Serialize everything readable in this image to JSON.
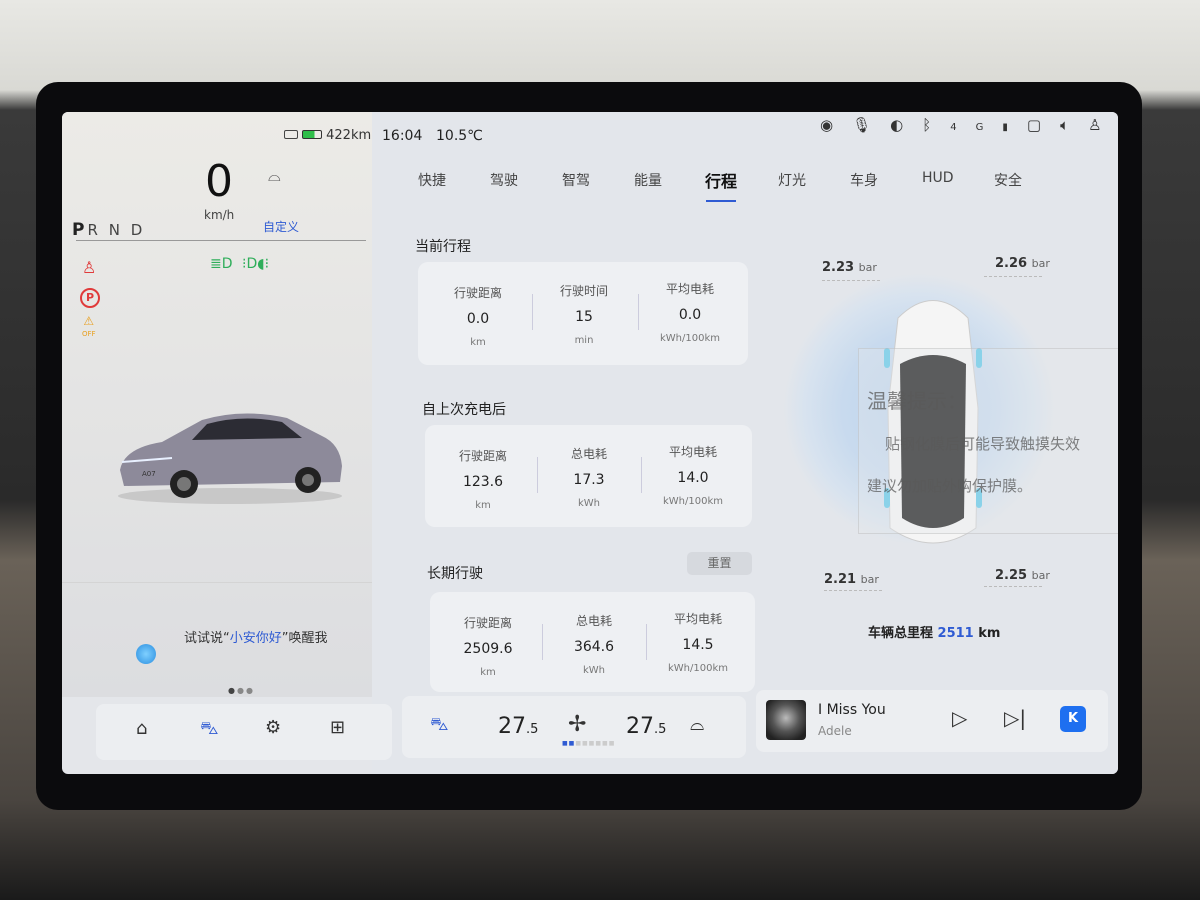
{
  "cluster": {
    "range": "422km",
    "speed": "0",
    "speed_unit": "km/h",
    "custom": "自定义",
    "gears": [
      "P",
      "R",
      "N",
      "D"
    ],
    "active_gear": "P",
    "voice_prompt_prefix": "试试说“",
    "voice_wake_word": "小安你好",
    "voice_prompt_suffix": "”唤醒我",
    "car_badge": "A07",
    "page_dots": 3,
    "page_active": 1,
    "off_label": "OFF"
  },
  "status": {
    "time": "16:04",
    "temperature": "10.5℃",
    "icons": [
      "camera-icon",
      "microphone-icon",
      "satellite-icon",
      "bluetooth-icon",
      "signal-4g-icon",
      "dashcam-icon",
      "volume-icon",
      "user-icon"
    ],
    "signal_label": "4G"
  },
  "tabs": [
    {
      "label": "快捷"
    },
    {
      "label": "驾驶"
    },
    {
      "label": "智驾"
    },
    {
      "label": "能量"
    },
    {
      "label": "行程",
      "active": true
    },
    {
      "label": "灯光"
    },
    {
      "label": "车身"
    },
    {
      "label": "HUD"
    },
    {
      "label": "安全"
    }
  ],
  "trips": {
    "current": {
      "title": "当前行程",
      "cells": [
        {
          "label": "行驶距离",
          "value": "0.0",
          "unit": "km"
        },
        {
          "label": "行驶时间",
          "value": "15",
          "unit": "min"
        },
        {
          "label": "平均电耗",
          "value": "0.0",
          "unit": "kWh/100km"
        }
      ]
    },
    "since_charge": {
      "title": "自上次充电后",
      "cells": [
        {
          "label": "行驶距离",
          "value": "123.6",
          "unit": "km"
        },
        {
          "label": "总电耗",
          "value": "17.3",
          "unit": "kWh"
        },
        {
          "label": "平均电耗",
          "value": "14.0",
          "unit": "kWh/100km"
        }
      ]
    },
    "long_term": {
      "title": "长期行驶",
      "reset": "重置",
      "cells": [
        {
          "label": "行驶距离",
          "value": "2509.6",
          "unit": "km"
        },
        {
          "label": "总电耗",
          "value": "364.6",
          "unit": "kWh"
        },
        {
          "label": "平均电耗",
          "value": "14.5",
          "unit": "kWh/100km"
        }
      ]
    }
  },
  "tires": {
    "front_left": "2.23",
    "front_right": "2.26",
    "rear_left": "2.21",
    "rear_right": "2.25",
    "unit": "bar"
  },
  "odometer": {
    "label": "车辆总里程",
    "value": "2511",
    "unit": "km"
  },
  "sticker": {
    "title": "温馨提示：",
    "line1": "贴钢化膜后可能导致触摸失效",
    "line2": "建议勿加贴外购保护膜。"
  },
  "climate": {
    "left_temp": "27",
    "left_decimal": ".5",
    "right_temp": "27",
    "right_decimal": ".5",
    "fan_level": 2,
    "fan_max": 8
  },
  "media": {
    "title": "I Miss You",
    "artist": "Adele",
    "app_letter": "K"
  },
  "colors": {
    "accent": "#2f5bd3",
    "warning_red": "#e03a3a",
    "warning_amber": "#e8a020",
    "light_green": "#2fae5a",
    "battery_green": "#2fbe4a"
  }
}
